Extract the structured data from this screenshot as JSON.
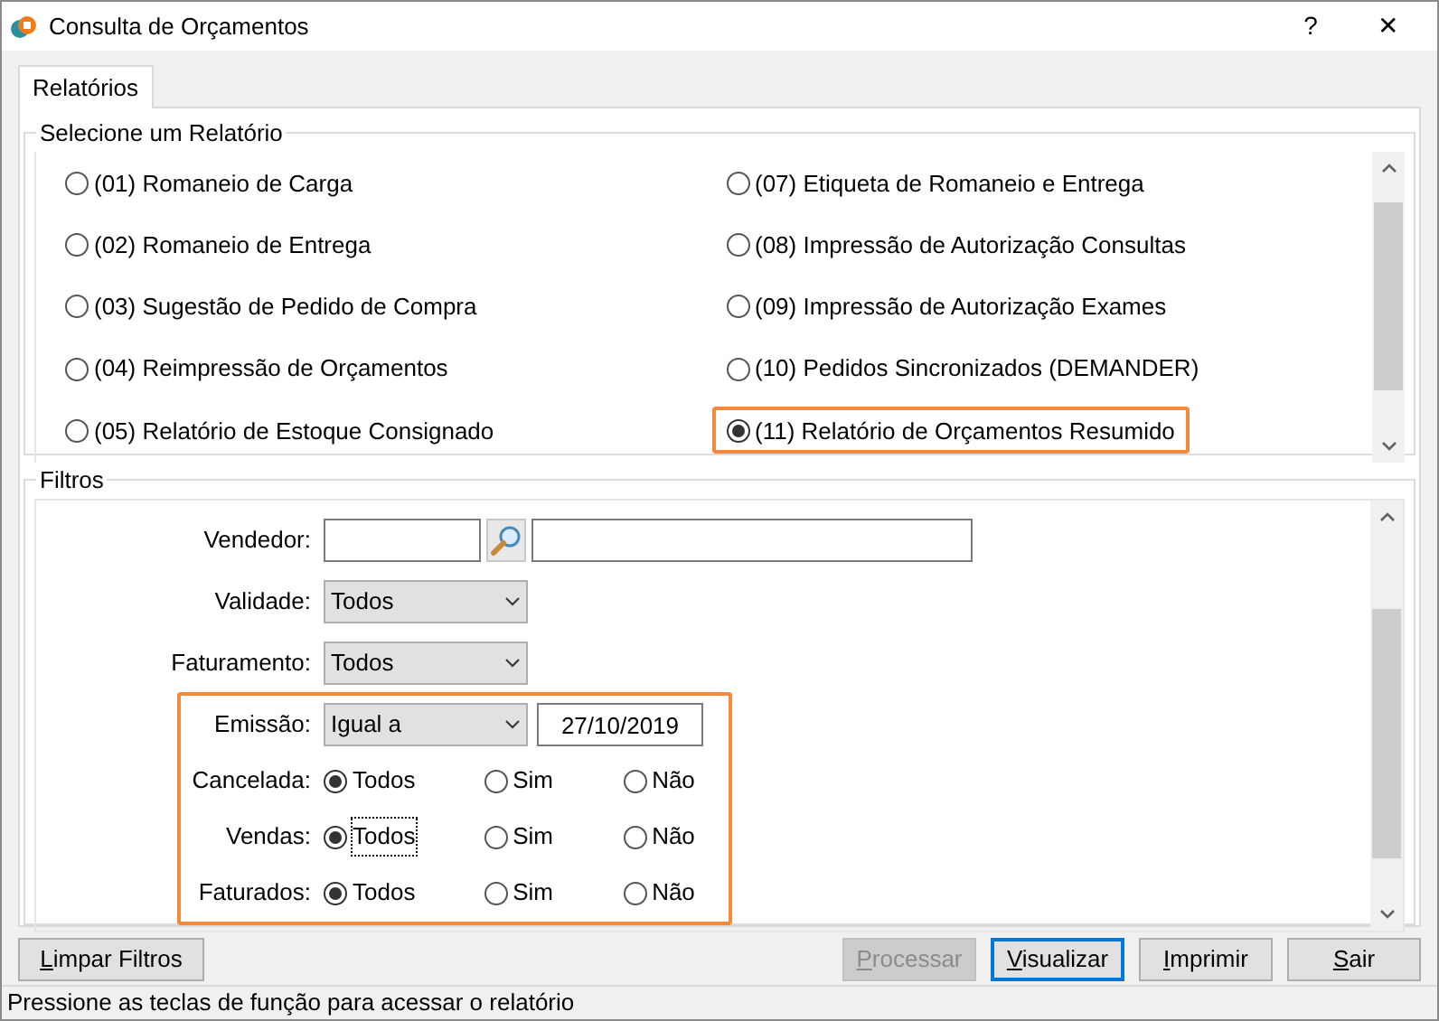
{
  "window": {
    "title": "Consulta de Orçamentos",
    "help": "?",
    "close": "✕"
  },
  "tabs": [
    {
      "label": "Relatórios",
      "selected": true
    }
  ],
  "reports_group": {
    "title": "Selecione um Relatório",
    "items": [
      {
        "label": "(01) Romaneio de Carga",
        "selected": false,
        "highlighted": false
      },
      {
        "label": "(02) Romaneio de Entrega",
        "selected": false,
        "highlighted": false
      },
      {
        "label": "(03) Sugestão de Pedido de Compra",
        "selected": false,
        "highlighted": false
      },
      {
        "label": "(04) Reimpressão de Orçamentos",
        "selected": false,
        "highlighted": false
      },
      {
        "label": "(05) Relatório de Estoque Consignado",
        "selected": false,
        "highlighted": false
      },
      {
        "label": "(07) Etiqueta de Romaneio e Entrega",
        "selected": false,
        "highlighted": false
      },
      {
        "label": "(08) Impressão de Autorização Consultas",
        "selected": false,
        "highlighted": false
      },
      {
        "label": "(09) Impressão de Autorização Exames",
        "selected": false,
        "highlighted": false
      },
      {
        "label": "(10) Pedidos Sincronizados (DEMANDER)",
        "selected": false,
        "highlighted": false
      },
      {
        "label": "(11) Relatório de Orçamentos Resumido",
        "selected": true,
        "highlighted": true
      }
    ]
  },
  "filters_group": {
    "title": "Filtros",
    "vendedor": {
      "label": "Vendedor:"
    },
    "rows": [
      {
        "kind": "select",
        "label": "Validade:",
        "value": "Todos",
        "highlighted": false
      },
      {
        "kind": "select",
        "label": "Faturamento:",
        "value": "Todos",
        "highlighted": false
      },
      {
        "kind": "select_date",
        "label": "Emissão:",
        "value": "Igual a",
        "date": "27/10/2019",
        "highlighted": true
      },
      {
        "kind": "radios",
        "label": "Cancelada:",
        "highlighted": true,
        "options": [
          {
            "label": "Todos",
            "selected": true,
            "focused": false
          },
          {
            "label": "Sim",
            "selected": false,
            "focused": false
          },
          {
            "label": "Não",
            "selected": false,
            "focused": false
          }
        ]
      },
      {
        "kind": "radios",
        "label": "Vendas:",
        "highlighted": true,
        "options": [
          {
            "label": "Todos",
            "selected": true,
            "focused": true
          },
          {
            "label": "Sim",
            "selected": false,
            "focused": false
          },
          {
            "label": "Não",
            "selected": false,
            "focused": false
          }
        ]
      },
      {
        "kind": "radios",
        "label": "Faturados:",
        "highlighted": true,
        "options": [
          {
            "label": "Todos",
            "selected": true,
            "focused": false
          },
          {
            "label": "Sim",
            "selected": false,
            "focused": false
          },
          {
            "label": "Não",
            "selected": false,
            "focused": false
          }
        ]
      }
    ]
  },
  "buttons": [
    {
      "label": "Limpar Filtros",
      "disabled": false,
      "focused": false
    },
    {
      "label": "Processar",
      "disabled": true,
      "focused": false
    },
    {
      "label": "Visualizar",
      "disabled": false,
      "focused": true
    },
    {
      "label": "Imprimir",
      "disabled": false,
      "focused": false
    },
    {
      "label": "Sair",
      "disabled": false,
      "focused": false
    }
  ],
  "status_bar": "Pressione as teclas de função para acessar o relatório"
}
